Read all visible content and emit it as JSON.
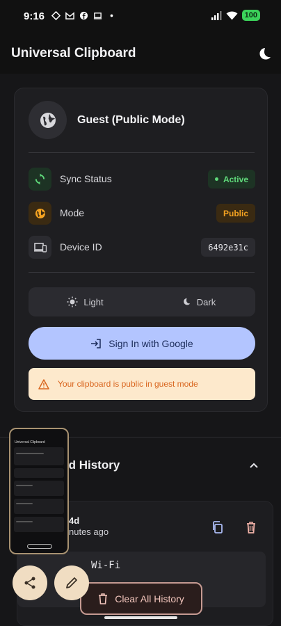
{
  "status_bar": {
    "time": "9:16",
    "battery": "100"
  },
  "header": {
    "title": "Universal Clipboard",
    "theme_icon": "moon-icon"
  },
  "profile": {
    "name": "Guest (Public Mode)",
    "avatar_icon": "globe-icon"
  },
  "info_rows": [
    {
      "label": "Sync Status",
      "value": "Active",
      "icon": "sync-icon",
      "color": "#5fd97a"
    },
    {
      "label": "Mode",
      "value": "Public",
      "icon": "public-globe-icon",
      "color": "#f5a321"
    },
    {
      "label": "Device ID",
      "value": "6492e31c",
      "icon": "devices-icon"
    }
  ],
  "theme_switch": {
    "light_label": "Light",
    "dark_label": "Dark"
  },
  "sign_in": {
    "label": "Sign In with Google"
  },
  "warning": {
    "text": "Your clipboard is public in guest mode"
  },
  "history": {
    "title_visible": "rd History",
    "item": {
      "device_visible": "4d",
      "time_visible": "nutes ago",
      "content_visible": "Wi-Fi"
    }
  },
  "clear_button": {
    "label": "Clear All History"
  },
  "thumbnail": {
    "title": "Universal Clipboard"
  },
  "colors": {
    "accent": "#b3c5ff",
    "active_green": "#5fd97a",
    "public_orange": "#f5a321",
    "warning_bg": "#fde9cc",
    "fab_bg": "#f0ddc2"
  }
}
